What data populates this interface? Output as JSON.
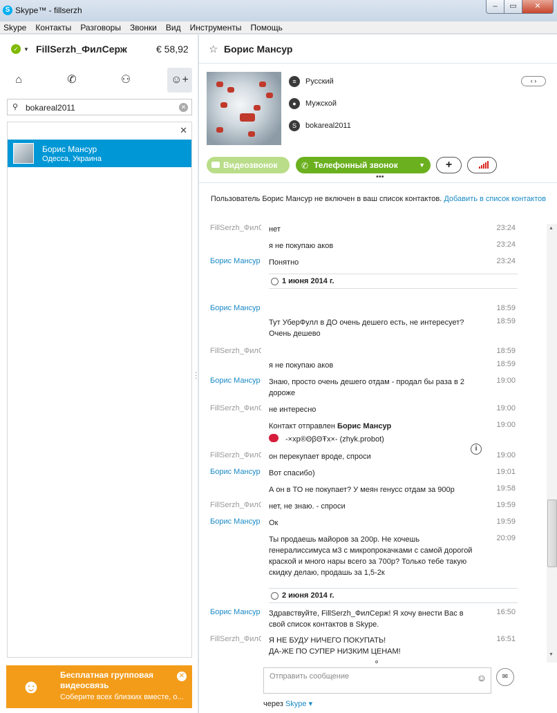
{
  "window": {
    "title": "Skype™ - fillserzh",
    "min": "–",
    "max": "▭",
    "close": "✕"
  },
  "menu": [
    "Skype",
    "Контакты",
    "Разговоры",
    "Звонки",
    "Вид",
    "Инструменты",
    "Помощь"
  ],
  "account": {
    "name": "FillSerzh_ФилСерж",
    "balance": "€ 58,92"
  },
  "search": {
    "value": "bokareal2011"
  },
  "results": {
    "close": "✕",
    "items": [
      {
        "name": "Борис Мансур",
        "location": "Одесса, Украина"
      }
    ]
  },
  "promo": {
    "title": "Бесплатная групповая видеосвязь",
    "subtitle": "Соберите всех близких вместе, о..."
  },
  "contact": {
    "name": "Борис Мансур",
    "language": "Русский",
    "gender": "Мужской",
    "skype_id": "bokareal2011",
    "pager": "‹ ›"
  },
  "actions": {
    "video": "Видеозвонок",
    "call": "Телефонный звонок"
  },
  "notice": {
    "text": "Пользователь Борис Мансур не включен в ваш список контактов.",
    "link": "Добавить в список контактов"
  },
  "messages": [
    {
      "sender": "FillSerzh_ФилСерж",
      "me": true,
      "text": "нет",
      "time": "23:24"
    },
    {
      "sender": "",
      "me": true,
      "text": "я не покупаю аков",
      "time": "23:24"
    },
    {
      "sender": "Борис Мансур",
      "me": false,
      "text": "Понятно",
      "time": "23:24"
    },
    {
      "date": "1 июня 2014 г."
    },
    {
      "sender": "Борис Мансур",
      "me": false,
      "text": "",
      "time": "18:59"
    },
    {
      "sender": "",
      "me": false,
      "text": "Тут УберФулл в ДО очень дешего есть, не интересует? Очень дешево",
      "time": "18:59"
    },
    {
      "sender": "FillSerzh_ФилСерж",
      "me": true,
      "text": "",
      "time": "18:59"
    },
    {
      "sender": "",
      "me": true,
      "text": "я не покупаю аков",
      "time": "18:59"
    },
    {
      "sender": "Борис Мансур",
      "me": false,
      "text": "Знаю, просто очень дешего отдам - продал бы раза в 2 дороже",
      "time": "19:00"
    },
    {
      "sender": "FillSerzh_ФилСерж",
      "me": true,
      "text": "не интересно",
      "time": "19:00"
    },
    {
      "sender": "",
      "me": false,
      "text": "Контакт отправлен",
      "bold": "Борис Мансур",
      "card": "-×хр®ΘβΘŦх×- (zhyk.probot)",
      "time": "19:00"
    },
    {
      "sender": "FillSerzh_ФилСерж",
      "me": true,
      "text": "он перекупает вроде, спроси",
      "time": "19:00"
    },
    {
      "sender": "Борис Мансур",
      "me": false,
      "text": "Вот спасибо)",
      "time": "19:01"
    },
    {
      "sender": "",
      "me": false,
      "text": "А он в ТО не покупает? У меян генусс отдам за 900р",
      "time": "19:58"
    },
    {
      "sender": "FillSerzh_ФилСерж",
      "me": true,
      "text": "нет, не знаю. - спроси",
      "time": "19:59"
    },
    {
      "sender": "Борис Мансур",
      "me": false,
      "text": "Ок",
      "time": "19:59"
    },
    {
      "sender": "",
      "me": false,
      "text": "Ты продаешь майоров за 200р. Не хочешь генералиссимуса м3 с микропрокачками с самой дорогой краской и много нары всего за 700р? Только тебе такую скидку делаю, продашь за 1,5-2к",
      "time": "20:09"
    },
    {
      "date": "2 июня 2014 г."
    },
    {
      "sender": "Борис Мансур",
      "me": false,
      "text": "Здравствуйте, FillSerzh_ФилСерж! Я хочу внести Вас в свой список контактов в Skype.",
      "time": "16:50"
    },
    {
      "sender": "FillSerzh_ФилСерж",
      "me": true,
      "text": "Я НЕ БУДУ НИЧЕГО ПОКУПАТЬ!\nДА-ЖЕ ПО СУПЕР НИЗКИМ ЦЕНАМ!",
      "time": "16:51"
    }
  ],
  "composer": {
    "placeholder": "Отправить сообщение",
    "via_prefix": "через",
    "via_service": "Skype"
  },
  "colors": {
    "accent": "#0097d6",
    "call_green": "#6bb01f",
    "video_green": "#b9dd88",
    "promo": "#f39c1a",
    "link": "#1a8ac6"
  },
  "icons": [
    "home-icon",
    "phone-icon",
    "group-icon",
    "add-contact-icon",
    "search-icon",
    "clear-icon",
    "star-icon",
    "language-icon",
    "gender-icon",
    "skype-icon",
    "video-icon",
    "call-icon",
    "plus-icon",
    "signal-icon",
    "clock-icon",
    "emoticon-icon",
    "send-icon"
  ]
}
